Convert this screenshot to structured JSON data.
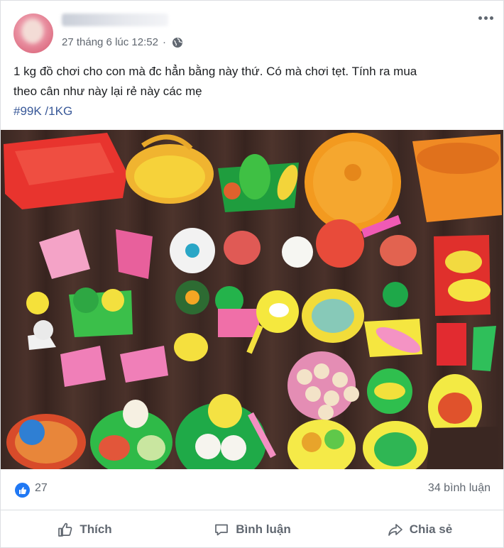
{
  "post": {
    "timestamp": "27 tháng 6 lúc 12:52",
    "text_line1": "1 kg đồ chơi cho con mà đc hẳn bằng này thứ. Có mà chơi tẹt. Tính ra mua",
    "text_line2": "theo cân như này lại rẻ này các mẹ",
    "hashtag": "#99K",
    "hashtag_suffix": " /1KG"
  },
  "stats": {
    "reactions": "27",
    "comments": "34 bình luận"
  },
  "actions": {
    "like": "Thích",
    "comment": "Bình luận",
    "share": "Chia sẻ"
  },
  "icons": {
    "privacy": "globe-icon",
    "more": "more-icon",
    "like": "thumb-up-icon",
    "comment": "comment-icon",
    "share": "share-icon"
  },
  "colors": {
    "link": "#385898",
    "reaction": "#2078f4",
    "muted": "#606770"
  }
}
